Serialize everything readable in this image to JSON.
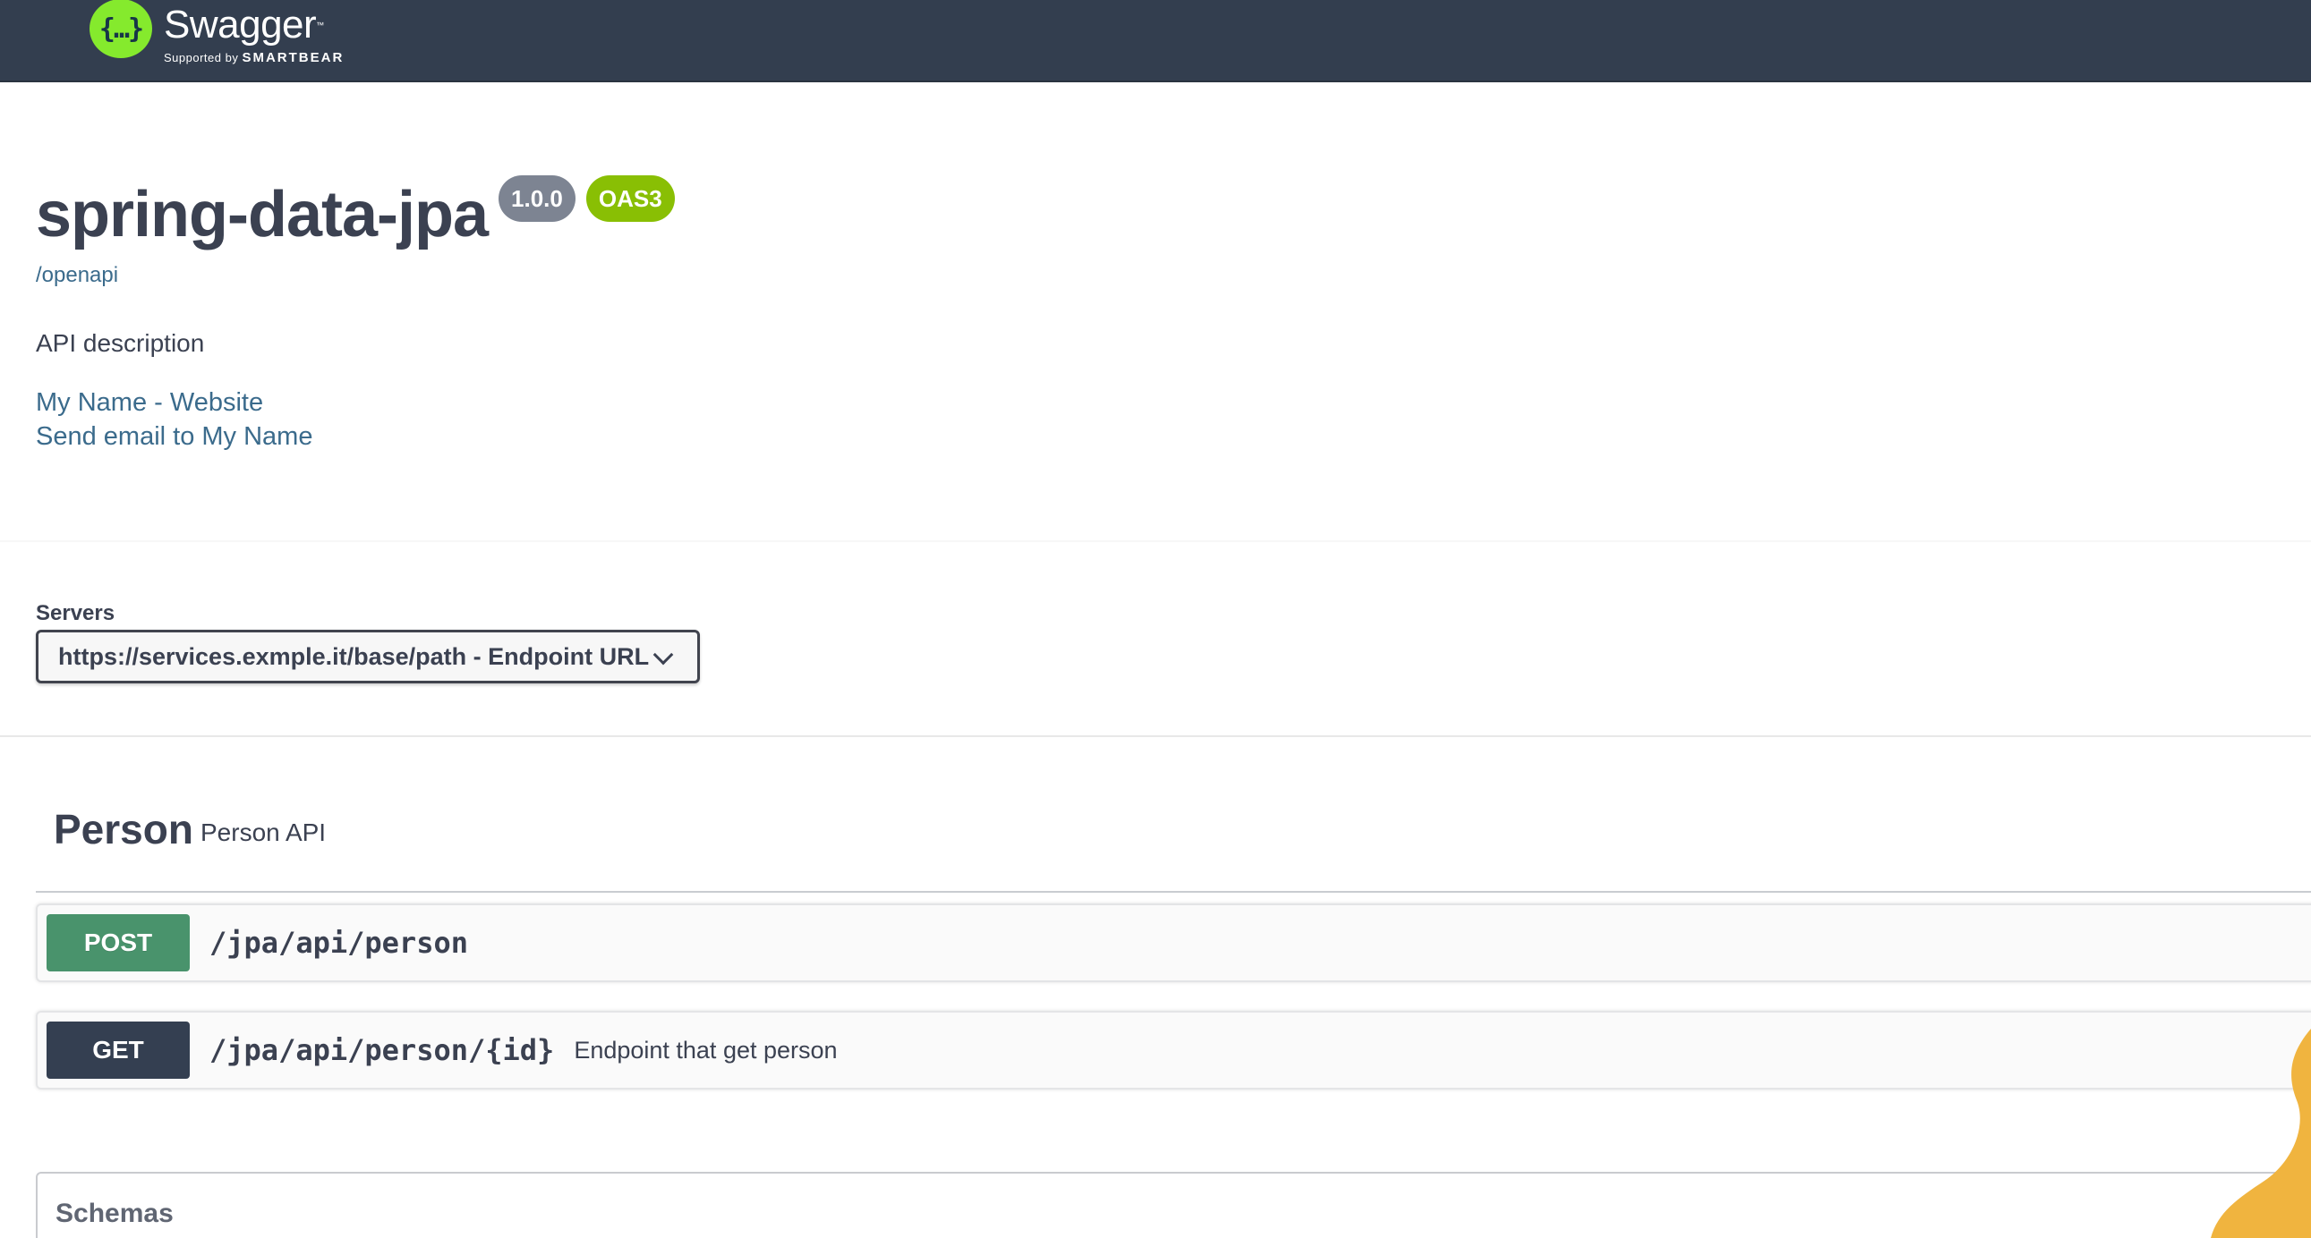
{
  "header": {
    "logo_name": "Swagger",
    "logo_tm": "™",
    "logo_sub_prefix": "Supported by",
    "logo_sub_brand": "SMARTBEAR",
    "logo_glyph": "{…}"
  },
  "info": {
    "title": "spring-data-jpa",
    "version_badge": "1.0.0",
    "oas_badge": "OAS3",
    "spec_link": "/openapi",
    "description": "API description",
    "contact_links": [
      "My Name - Website",
      "Send email to My Name"
    ]
  },
  "servers": {
    "label": "Servers",
    "selected": "https://services.exmple.it/base/path - Endpoint URL"
  },
  "tag": {
    "name": "Person",
    "description": "Person API"
  },
  "operations": [
    {
      "method": "POST",
      "path": "/jpa/api/person",
      "summary": ""
    },
    {
      "method": "GET",
      "path": "/jpa/api/person/{id}",
      "summary": "Endpoint that get person"
    }
  ],
  "schemas": {
    "title": "Schemas"
  },
  "colors": {
    "topbar": "#333e4f",
    "logo_green": "#85ea2d",
    "post": "#49936c",
    "get": "#343f51",
    "oas_badge": "#89bf04",
    "version_badge": "#7d8492",
    "link": "#3b6b8c"
  }
}
